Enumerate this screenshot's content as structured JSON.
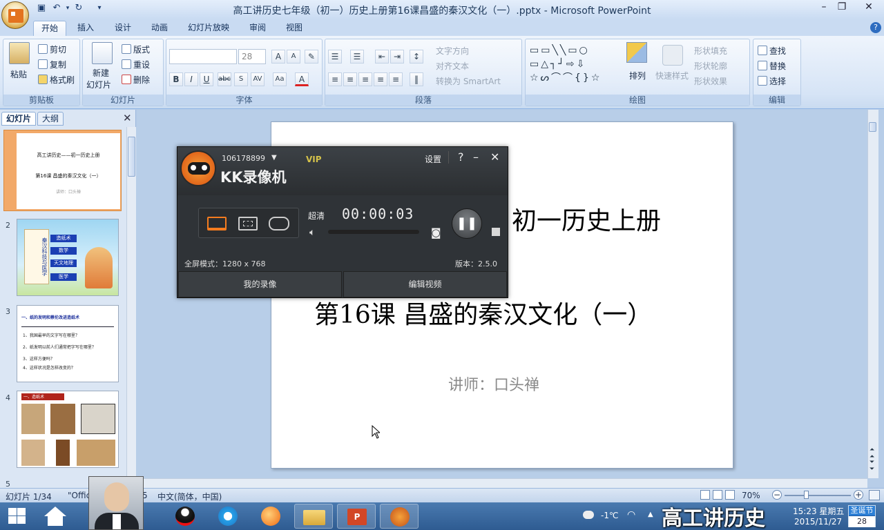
{
  "window": {
    "title": "高工讲历史七年级（初一）历史上册第16课昌盛的秦汉文化（一）.pptx - Microsoft PowerPoint"
  },
  "tabs": [
    "开始",
    "插入",
    "设计",
    "动画",
    "幻灯片放映",
    "审阅",
    "视图"
  ],
  "ribbon": {
    "clipboard": {
      "label": "剪贴板",
      "paste": "粘贴",
      "cut": "剪切",
      "copy": "复制",
      "format_painter": "格式刷"
    },
    "slides": {
      "label": "幻灯片",
      "new_slide_1": "新建",
      "new_slide_2": "幻灯片",
      "layout": "版式",
      "reset": "重设",
      "delete": "删除"
    },
    "font": {
      "label": "字体",
      "font_size": "28"
    },
    "paragraph": {
      "label": "段落",
      "text_direction": "文字方向",
      "align_text": "对齐文本",
      "smartart": "转换为 SmartArt"
    },
    "drawing": {
      "label": "绘图",
      "arrange": "排列",
      "quick_styles": "快速样式",
      "shape_fill": "形状填充",
      "shape_outline": "形状轮廓",
      "shape_effects": "形状效果"
    },
    "editing": {
      "label": "编辑",
      "find": "查找",
      "replace": "替换",
      "select": "选择"
    }
  },
  "pane": {
    "tab_slides": "幻灯片",
    "tab_outline": "大纲",
    "numbers": [
      "1",
      "2",
      "3",
      "4",
      "5"
    ],
    "thumb1": {
      "line1": "高工讲历史——初一历史上册",
      "line2": "第16课 昌盛的秦汉文化（一）",
      "line3": "讲师：口头禅"
    },
    "thumb2": {
      "left": "秦汉科技与医学",
      "items": [
        "造纸术",
        "数学",
        "天文地理",
        "医学"
      ]
    },
    "thumb3": {
      "header": "一、纸的发明和蔡伦改进造纸术",
      "lines": [
        "1、我国最早的文字写在哪里？",
        "2、纸发明以前人们通常把字写在哪里？",
        "3、这样方便吗？",
        "4、这样状况是怎样改变的？"
      ]
    },
    "thumb4": {
      "header": "一、造纸术"
    }
  },
  "slide": {
    "title_fragment": "初一历史上册",
    "subtitle": "第16课 昌盛的秦汉文化（一）",
    "lecturer": "讲师：口头禅"
  },
  "recorder": {
    "user_id": "106178899",
    "vip": "VIP",
    "settings": "设置",
    "app_name": "KK录像机",
    "quality": "超清",
    "timer": "00:00:03",
    "mode": "全屏模式：1280 x 768",
    "version": "版本：2.5.0",
    "my_recordings": "我的录像",
    "edit_video": "编辑视频"
  },
  "status": {
    "slide_counter": "幻灯片 1/34",
    "theme": "\"Offic",
    "theme_tail": "5",
    "language": "中文(简体，中国)",
    "zoom": "70%"
  },
  "taskbar": {
    "weather": "-1℃",
    "time": "15:23 星期五",
    "date": "2015/11/27",
    "holiday": "圣诞节",
    "holiday_day": "28",
    "overlay_text": "高工讲历史"
  },
  "colors": {
    "accent": "#f57c1f",
    "ribbon": "#dbe7f6",
    "taskbar": "#3a6aa3"
  }
}
